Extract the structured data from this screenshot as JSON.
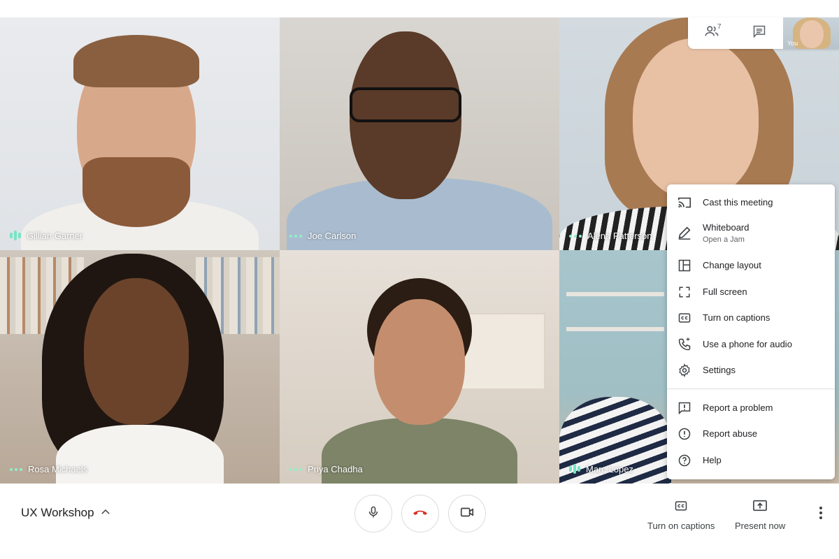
{
  "participants": [
    {
      "name": "Gillian Garner",
      "indicator": "bars"
    },
    {
      "name": "Joe Carlson",
      "indicator": "dots"
    },
    {
      "name": "Alena Patterson",
      "indicator": "dots"
    },
    {
      "name": "Rosa Michaels",
      "indicator": "dots"
    },
    {
      "name": "Priya Chadha",
      "indicator": "dots"
    },
    {
      "name": "Marc Lopez",
      "indicator": "bars"
    }
  ],
  "top_panel": {
    "people_count": "7",
    "self_label": "You",
    "icons": [
      "people-icon",
      "chat-icon"
    ]
  },
  "menu": {
    "items": [
      {
        "label": "Cast this meeting",
        "icon": "cast-icon"
      },
      {
        "label": "Whiteboard",
        "sub": "Open a Jam",
        "icon": "pen-icon"
      },
      {
        "label": "Change layout",
        "icon": "layout-icon"
      },
      {
        "label": "Full screen",
        "icon": "fullscreen-icon"
      },
      {
        "label": "Turn on captions",
        "icon": "captions-icon"
      },
      {
        "label": "Use a phone for audio",
        "icon": "phone-icon"
      },
      {
        "label": "Settings",
        "icon": "gear-icon"
      },
      {
        "label": "Report a problem",
        "icon": "report-icon"
      },
      {
        "label": "Report abuse",
        "icon": "alert-icon"
      },
      {
        "label": "Help",
        "icon": "help-icon"
      }
    ]
  },
  "bottom_bar": {
    "meeting_title": "UX Workshop",
    "captions_label": "Turn on captions",
    "present_label": "Present now"
  },
  "colors": {
    "hangup_red": "#d93025",
    "speaking_green": "#76e4c6",
    "text_dark": "#202124",
    "text_grey": "#5f6368"
  }
}
